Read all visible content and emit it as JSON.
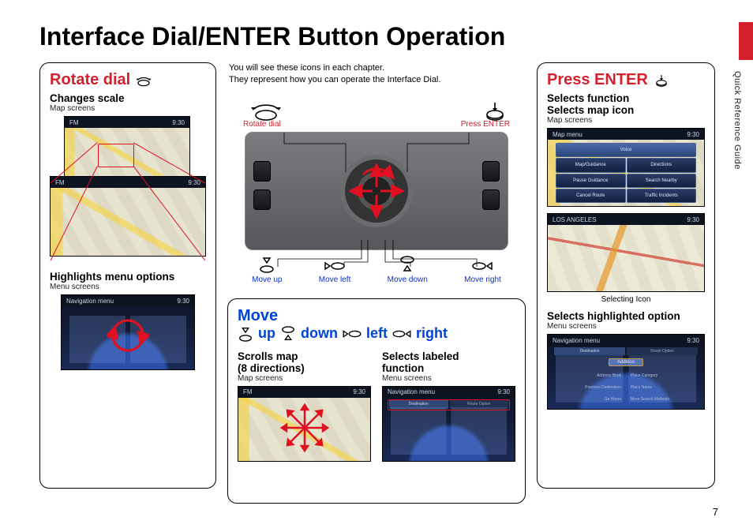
{
  "page": {
    "title": "Interface Dial/ENTER Button Operation",
    "side_label": "Quick Reference Guide",
    "number": "7"
  },
  "intro": {
    "line1": "You will see these icons in each chapter.",
    "line2": "They represent how you can operate the Interface Dial."
  },
  "diagram": {
    "rotate": "Rotate dial",
    "press": "Press ENTER",
    "move_up": "Move up",
    "move_left": "Move left",
    "move_down": "Move down",
    "move_right": "Move right"
  },
  "rotate": {
    "title": "Rotate dial",
    "sec1_title": "Changes scale",
    "sec1_ctx": "Map screens",
    "sec2_title": "Highlights menu options",
    "sec2_ctx": "Menu screens"
  },
  "move": {
    "title": "Move",
    "dirs": {
      "up": "up",
      "down": "down",
      "left": "left",
      "right": "right"
    },
    "sec1_title": "Scrolls map",
    "sec1_title2": "(8 directions)",
    "sec1_ctx": "Map screens",
    "sec2_title": "Selects labeled",
    "sec2_title2": "function",
    "sec2_ctx": "Menu screens"
  },
  "press": {
    "title": "Press ENTER",
    "sec1_title1": "Selects function",
    "sec1_title2": "Selects map icon",
    "sec1_ctx": "Map screens",
    "caption": "Selecting Icon",
    "sec2_title": "Selects highlighted option",
    "sec2_ctx": "Menu screens"
  },
  "screens": {
    "fm": "FM",
    "time": "9:30",
    "map_menu_title": "Map menu",
    "nav_menu_title": "Navigation menu",
    "los_angeles": "LOS ANGELES",
    "map_menu_items": [
      "Voice",
      "Map/Guidance",
      "Directions",
      "Pause Guidance",
      "Search Nearby",
      "Cancel Route",
      "Traffic Incidents"
    ],
    "nav_items_left": [
      "Address Book",
      "Previous Destination",
      "Go Home"
    ],
    "nav_items_right": [
      "Place Category",
      "Place Name",
      "More Search Methods"
    ],
    "nav_top_left": "Destination",
    "nav_top_right": "Route Option",
    "nav_center": "Address"
  }
}
